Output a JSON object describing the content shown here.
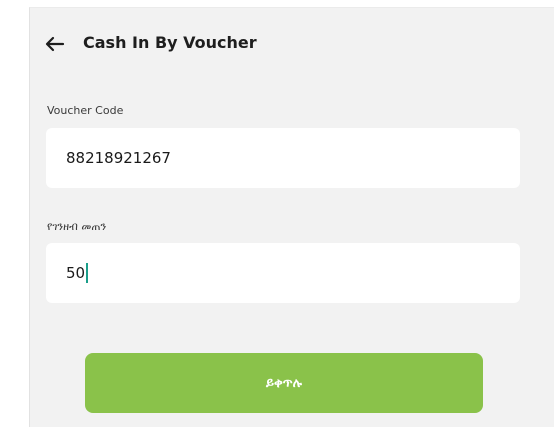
{
  "header": {
    "back_icon": "arrow-left-icon",
    "title": "Cash In By Voucher"
  },
  "form": {
    "voucher_code": {
      "label": "Voucher Code",
      "value": "88218921267"
    },
    "amount": {
      "label": "የገንዘብ መጠን",
      "value": "50"
    }
  },
  "submit": {
    "label": "ይቀጥሉ"
  },
  "colors": {
    "background": "#f2f2f2",
    "input_bg": "#ffffff",
    "button": "#8ac24a",
    "caret": "#1a9e8a",
    "text": "#1e1e1e"
  }
}
